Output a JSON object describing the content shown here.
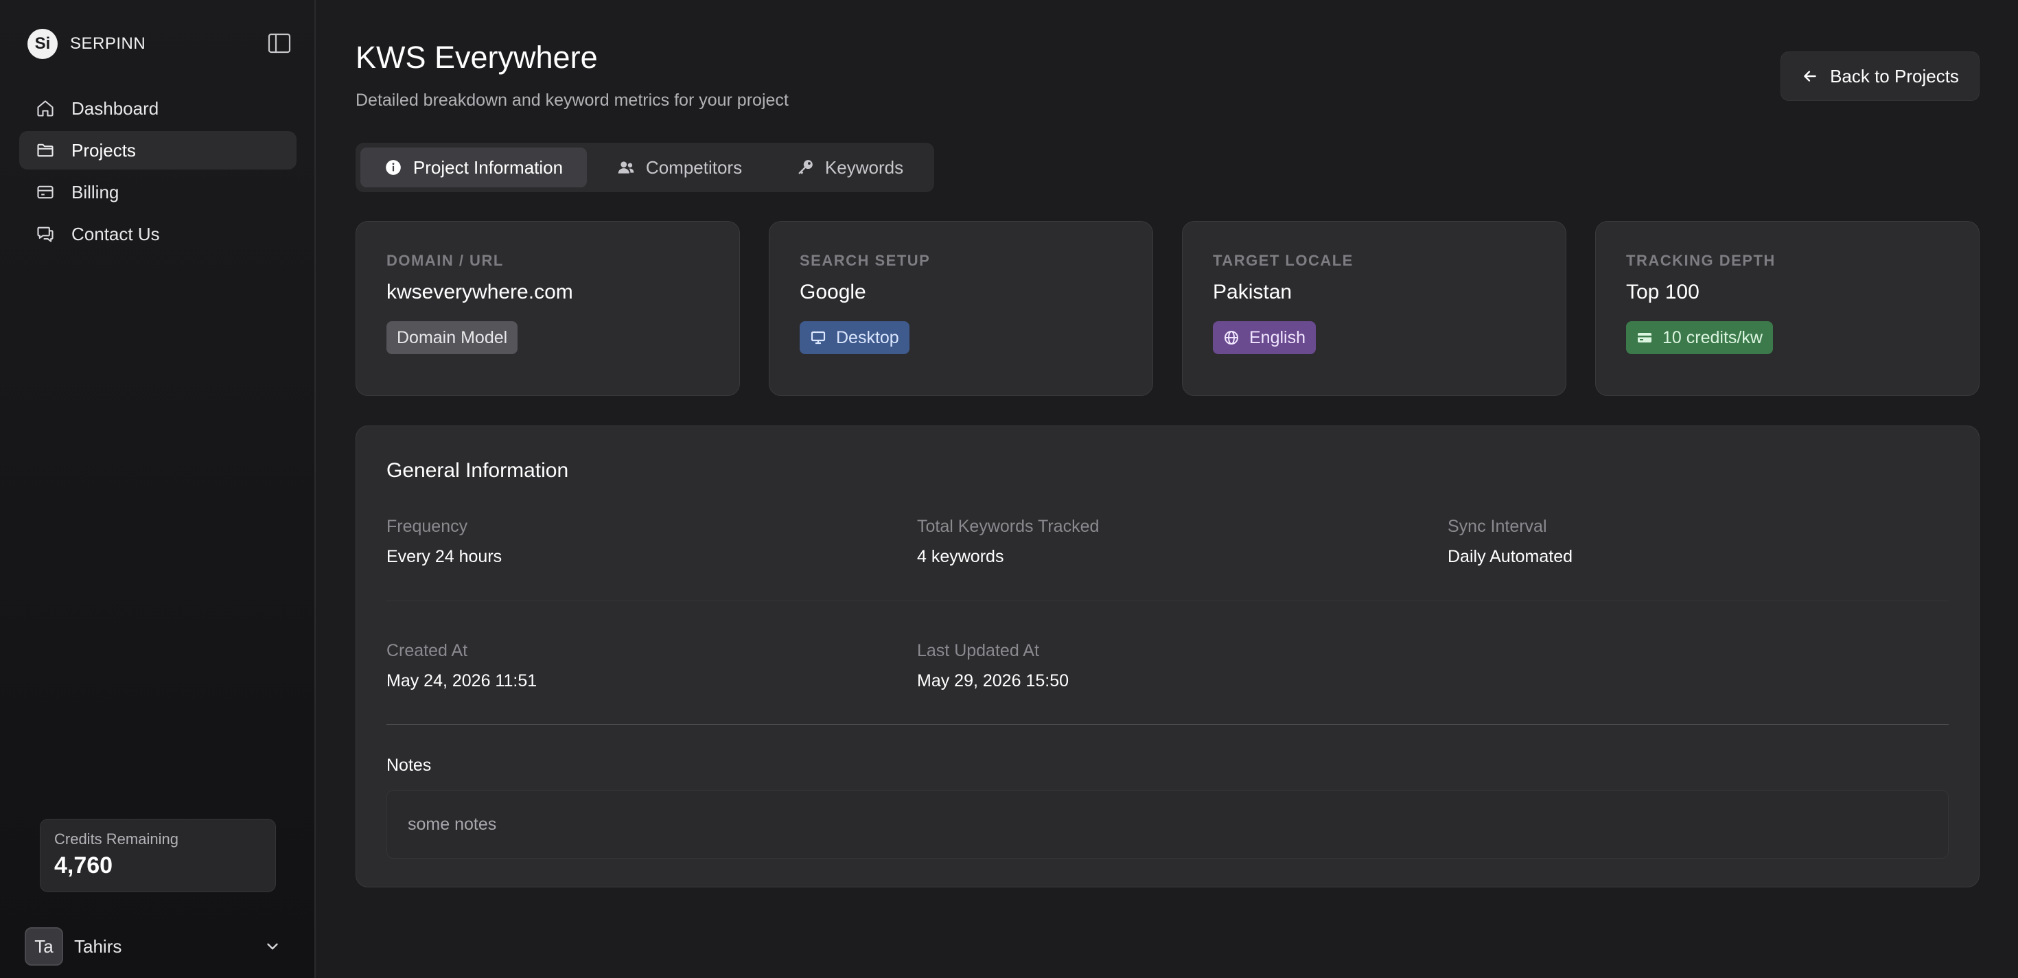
{
  "app": {
    "brand": "SERPINN",
    "logo_text": "Si"
  },
  "sidebar": {
    "items": [
      {
        "label": "Dashboard",
        "icon": "home-icon"
      },
      {
        "label": "Projects",
        "icon": "folder-icon"
      },
      {
        "label": "Billing",
        "icon": "credit-card-icon"
      },
      {
        "label": "Contact Us",
        "icon": "chat-icon"
      }
    ],
    "active": "Projects",
    "credits": {
      "label": "Credits Remaining",
      "value": "4,760"
    },
    "user": {
      "initials": "Ta",
      "name": "Tahirs"
    }
  },
  "header": {
    "title": "KWS Everywhere",
    "subtitle": "Detailed breakdown and keyword metrics for your project",
    "back_label": "Back to Projects"
  },
  "tabs": [
    {
      "label": "Project Information",
      "icon": "info-icon",
      "active": true
    },
    {
      "label": "Competitors",
      "icon": "users-icon",
      "active": false
    },
    {
      "label": "Keywords",
      "icon": "key-icon",
      "active": false
    }
  ],
  "cards": [
    {
      "label": "DOMAIN / URL",
      "value": "kwseverywhere.com",
      "chip": "Domain Model",
      "chip_color": "#55555a"
    },
    {
      "label": "SEARCH SETUP",
      "value": "Google",
      "chip": "Desktop",
      "chip_icon": "monitor-icon",
      "chip_color": "#3f5a8c"
    },
    {
      "label": "TARGET LOCALE",
      "value": "Pakistan",
      "chip": "English",
      "chip_icon": "globe-icon",
      "chip_color": "#6b4b8f"
    },
    {
      "label": "TRACKING DEPTH",
      "value": "Top 100",
      "chip": "10 credits/kw",
      "chip_icon": "credit-card-icon",
      "chip_color": "#3d7a4b"
    }
  ],
  "general": {
    "title": "General Information",
    "frequency": {
      "label": "Frequency",
      "value": "Every 24 hours"
    },
    "total_keywords": {
      "label": "Total Keywords Tracked",
      "value": "4 keywords"
    },
    "sync_interval": {
      "label": "Sync Interval",
      "value": "Daily Automated"
    },
    "created_at": {
      "label": "Created At",
      "value": "May 24, 2026 11:51"
    },
    "updated_at": {
      "label": "Last Updated At",
      "value": "May 29, 2026 15:50"
    },
    "notes": {
      "label": "Notes",
      "value": "some notes"
    }
  }
}
